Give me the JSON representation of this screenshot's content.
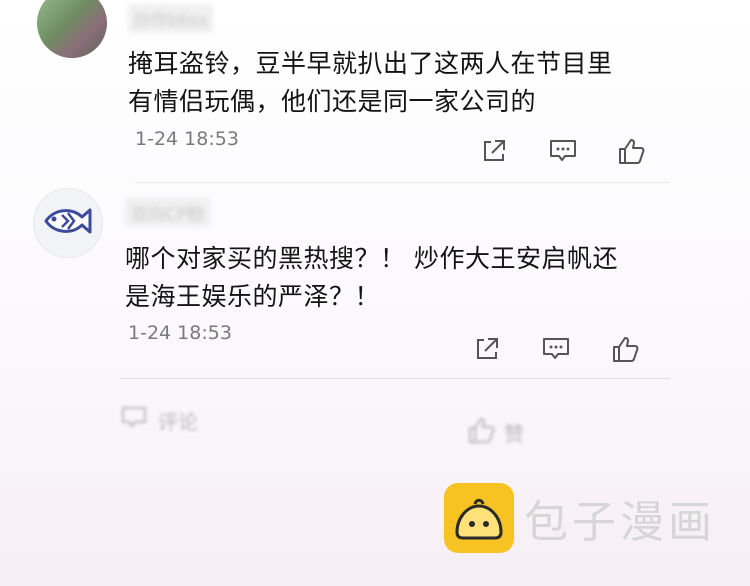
{
  "comments": [
    {
      "username": "炒作bbss",
      "text_line1": "掩耳盗铃，豆半早就扒出了这两人在节目里",
      "text_line2": "有情侣玩偶，他们还是同一家公司的",
      "time": "1-24 18:53"
    },
    {
      "username": "双向CP粉",
      "text_line1": "哪个对家买的黑热搜？！ 炒作大王安启帆还",
      "text_line2": "是海王娱乐的严泽？！",
      "time": "1-24 18:53"
    }
  ],
  "bottom_bar": {
    "comment_label": "评论",
    "like_label": "赞"
  },
  "watermark": {
    "brand_name": "包子漫画"
  },
  "icons": [
    "share-icon",
    "comment-icon",
    "like-icon",
    "fish-icon",
    "bun-logo-icon"
  ]
}
